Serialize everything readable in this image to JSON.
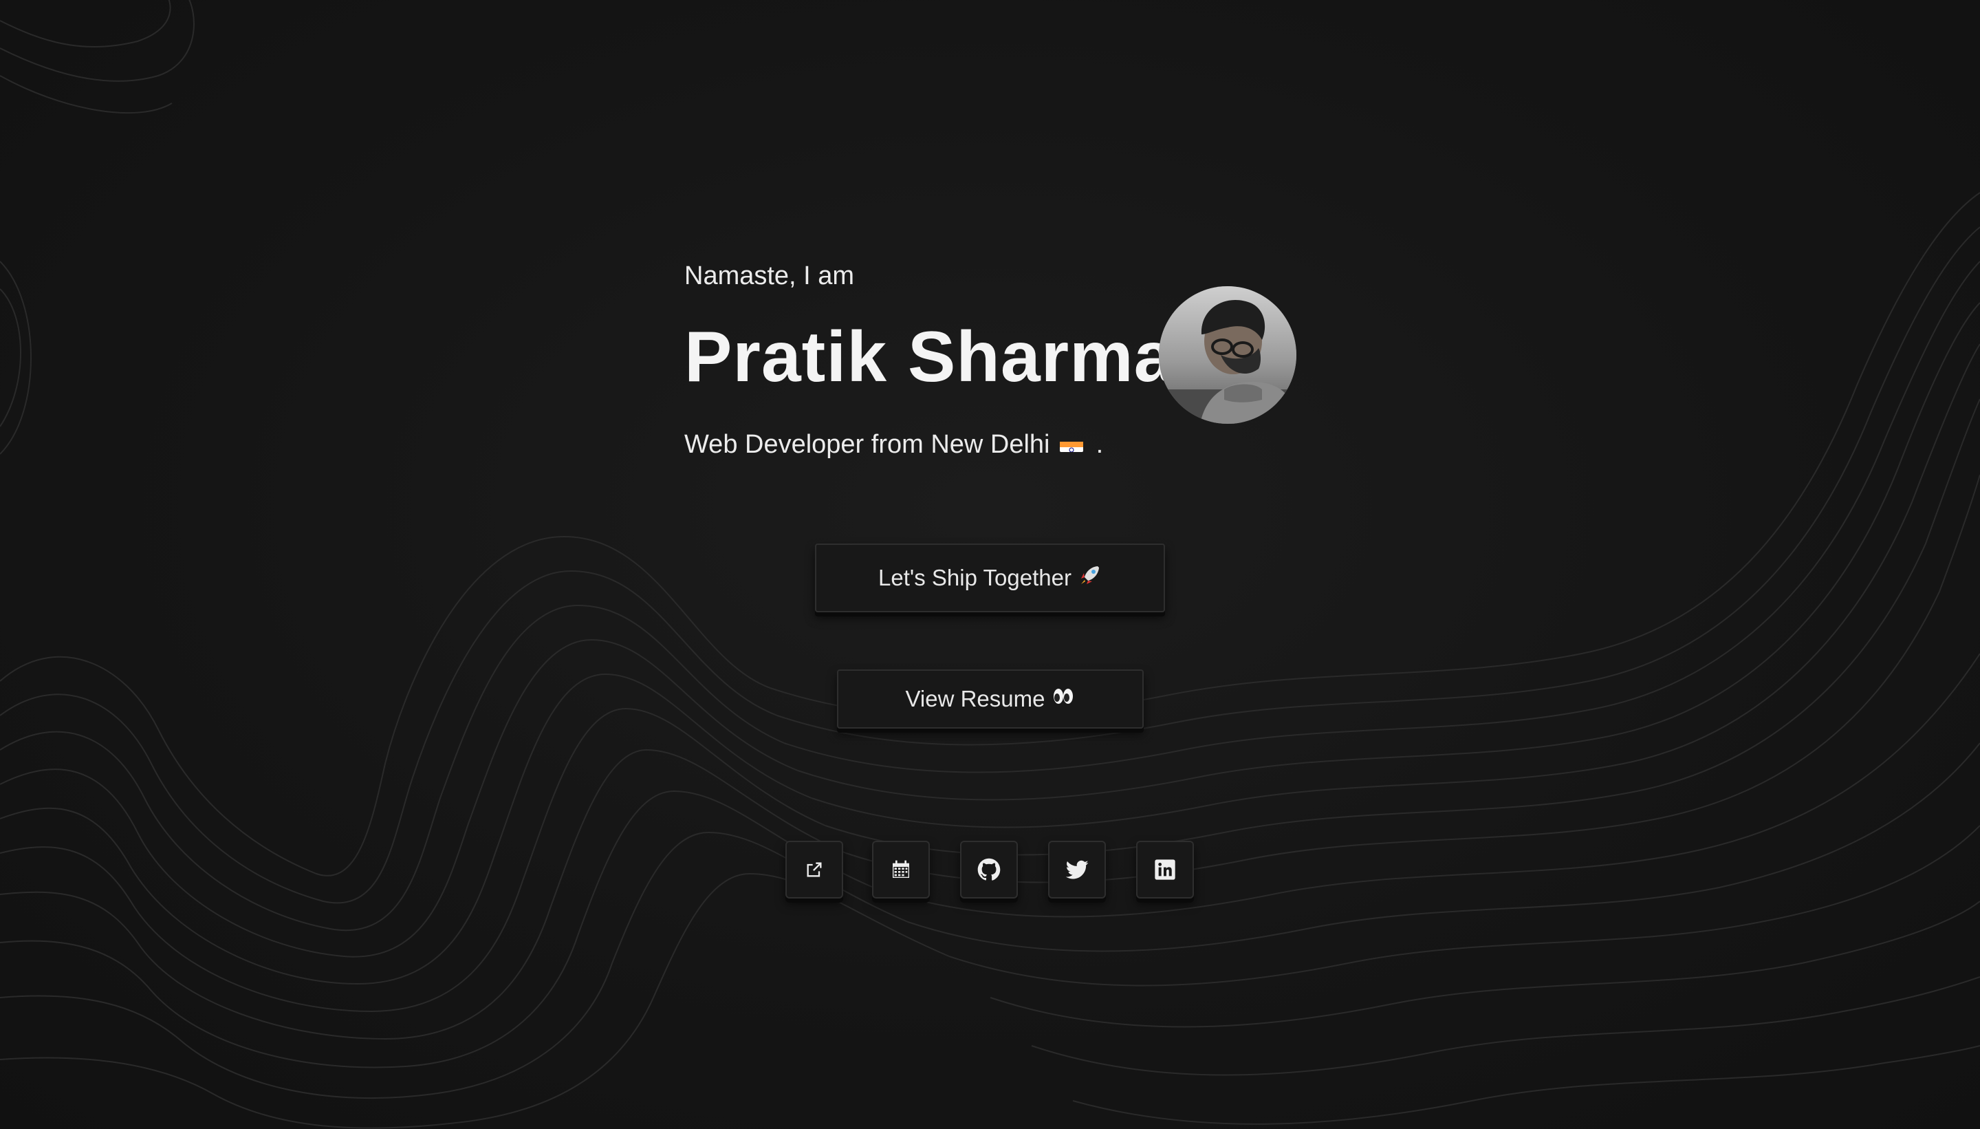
{
  "hero": {
    "greeting": "Namaste, I am",
    "name": "Pratik Sharma",
    "tagline_prefix": "Web Developer from New Delhi",
    "tagline_suffix": ".",
    "avatar_icon": "portrait-photo"
  },
  "buttons": {
    "ship_label": "Let's Ship Together",
    "ship_emoji": "rocket-icon",
    "resume_label": "View Resume",
    "resume_emoji": "eyes-icon"
  },
  "social": [
    {
      "icon": "external-link-icon"
    },
    {
      "icon": "calendar-icon"
    },
    {
      "icon": "github-icon"
    },
    {
      "icon": "twitter-icon"
    },
    {
      "icon": "linkedin-icon"
    }
  ],
  "colors": {
    "background": "#131313",
    "text": "#f2f2f2",
    "button_bg": "#181818",
    "button_border": "#2e2e2e",
    "contour": "#2a2a2a"
  }
}
